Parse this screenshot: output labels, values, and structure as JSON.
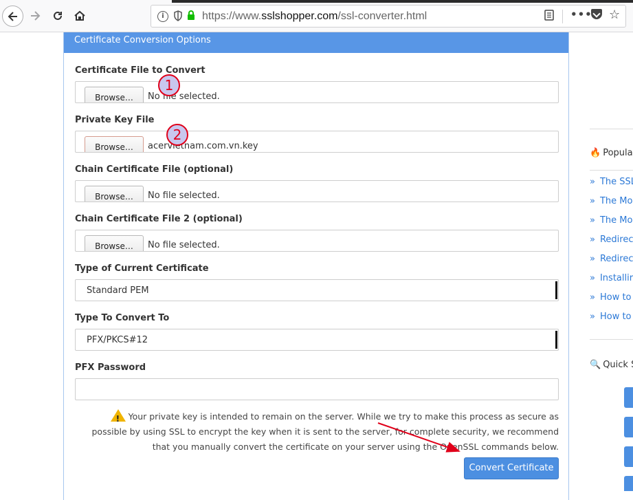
{
  "browser": {
    "url_prefix": "https://www.",
    "url_host": "sslshopper.com",
    "url_path": "/ssl-converter.html"
  },
  "panel": {
    "title": "Certificate Conversion Options",
    "cert_file": {
      "label": "Certificate File to Convert",
      "button": "Browse…",
      "status": "No file selected."
    },
    "key_file": {
      "label": "Private Key File",
      "button": "Browse…",
      "status": "acervietnam.com.vn.key"
    },
    "chain_file": {
      "label": "Chain Certificate File (optional)",
      "button": "Browse…",
      "status": "No file selected."
    },
    "chain_file2": {
      "label": "Chain Certificate File 2 (optional)",
      "button": "Browse…",
      "status": "No file selected."
    },
    "current_type": {
      "label": "Type of Current Certificate",
      "value": "Standard PEM"
    },
    "convert_to": {
      "label": "Type To Convert To",
      "value": "PFX/PKCS#12"
    },
    "pfx_password": {
      "label": "PFX Password",
      "value": ""
    },
    "warning": "Your private key is intended to remain on the server. While we try to make this process as secure as possible by using SSL to encrypt the key when it is sent to the server, for complete security, we recommend that you manually convert the certificate on your server using the OpenSSL commands below.",
    "convert_button": "Convert Certificate"
  },
  "annotations": {
    "marker1": "1",
    "marker2": "2",
    "color": "#e0001a"
  },
  "sidebar": {
    "popular_heading": "Popular",
    "links": [
      "The SSL",
      "The Mo",
      "The Mo",
      "Redirec",
      "Redirec",
      "Installir",
      "How to",
      "How to"
    ],
    "quick_heading": "Quick SS"
  },
  "colors": {
    "accent": "#5896e6",
    "button": "#4c8fe1",
    "link": "#2b78d6",
    "lock": "#12bc00"
  }
}
